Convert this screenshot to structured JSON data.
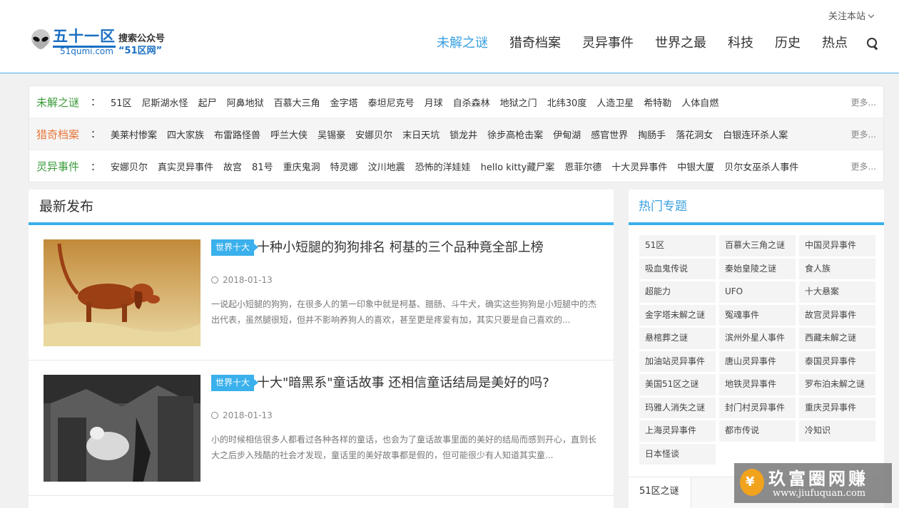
{
  "header": {
    "follow_label": "关注本站",
    "logo": {
      "title": "五十一区",
      "domain": "51qumi.com",
      "slogan1": "搜索公众号",
      "slogan2": "“51区网”"
    },
    "nav": [
      "未解之谜",
      "猎奇档案",
      "灵异事件",
      "世界之最",
      "科技",
      "历史",
      "热点"
    ],
    "active_nav": "未解之谜"
  },
  "tag_rows": [
    {
      "category": "未解之谜",
      "color": "#3a9a3a",
      "items": [
        "51区",
        "尼斯湖水怪",
        "起尸",
        "阿鼻地狱",
        "百慕大三角",
        "金字塔",
        "泰坦尼克号",
        "月球",
        "自杀森林",
        "地狱之门",
        "北纬30度",
        "人造卫星",
        "希特勒",
        "人体自燃"
      ],
      "more": "更多..."
    },
    {
      "category": "猎奇档案",
      "color": "#e8763c",
      "items": [
        "美莱村惨案",
        "四大家族",
        "布雷路怪兽",
        "呼兰大侠",
        "吴锡豪",
        "安娜贝尔",
        "末日天坑",
        "锁龙井",
        "徐步高枪击案",
        "伊甸湖",
        "感官世界",
        "掏肠手",
        "落花洞女",
        "白银连环杀人案"
      ],
      "more": "更多..."
    },
    {
      "category": "灵异事件",
      "color": "#3a9a3a",
      "items": [
        "安娜贝尔",
        "真实灵异事件",
        "故宫",
        "81号",
        "重庆鬼洞",
        "特灵娜",
        "汶川地震",
        "恐怖的洋娃娃",
        "hello kitty藏尸案",
        "恩菲尔德",
        "十大灵异事件",
        "中银大厦",
        "贝尔女巫杀人事件"
      ],
      "more": "更多..."
    }
  ],
  "main": {
    "heading": "最新发布",
    "articles": [
      {
        "badge": "世界十大",
        "title": "十种小短腿的狗狗排名 柯基的三个品种竟全部上榜",
        "date": "2018-01-13",
        "desc": "一说起小短腿的狗狗，在很多人的第一印象中就是柯基、腊肠、斗牛犬，确实这些狗狗是小短腿中的杰出代表，虽然腿很短，但并不影响养狗人的喜欢，甚至更是疼爱有加，其实只要是自己喜欢的..."
      },
      {
        "badge": "世界十大",
        "title": "十大\"暗黑系\"童话故事 还相信童话结局是美好的吗?",
        "date": "2018-01-13",
        "desc": "小的时候相信很多人都看过各种各样的童话，也会为了童话故事里面的美好的结局而感到开心，直到长大之后步入残酷的社会才发现，童话里的美好故事都是假的，但可能很少有人知道其实童..."
      }
    ]
  },
  "sidebar": {
    "heading": "热门专题",
    "topics": [
      "51区",
      "百慕大三角之谜",
      "中国灵异事件",
      "吸血鬼传说",
      "秦始皇陵之谜",
      "食人族",
      "超能力",
      "UFO",
      "十大悬案",
      "金字塔未解之谜",
      "冤魂事件",
      "故宫灵异事件",
      "悬棺葬之谜",
      "滨州外星人事件",
      "西藏未解之谜",
      "加油站灵异事件",
      "唐山灵异事件",
      "泰国灵异事件",
      "美国51区之谜",
      "地铁灵异事件",
      "罗布泊未解之谜",
      "玛雅人消失之谜",
      "封门村灵异事件",
      "重庆灵异事件",
      "上海灵异事件",
      "都市传说",
      "冷知识",
      "日本怪谈"
    ],
    "tab": "51区之谜"
  },
  "watermark": {
    "title": "玖富圈网赚",
    "url": "www.jiufuquan.com"
  },
  "colors": {
    "accent": "#3ab0ec",
    "brand": "#1a6fc2"
  }
}
